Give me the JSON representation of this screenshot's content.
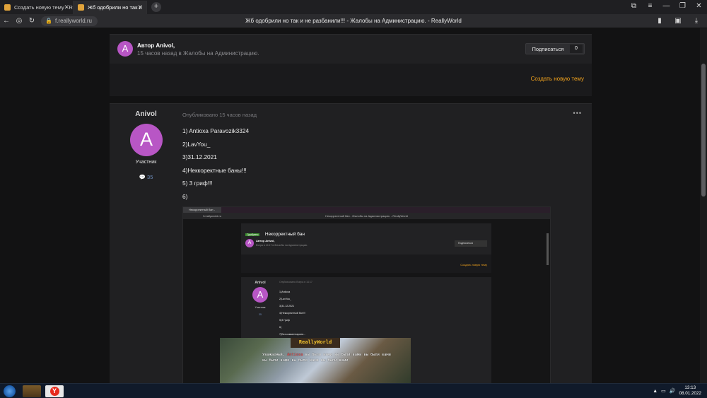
{
  "browser": {
    "tabs": [
      {
        "label": "Создать новую тему - Re",
        "active": false
      },
      {
        "label": "Жб одобрили но так и",
        "active": true
      }
    ],
    "new_tab_label": "+",
    "address": "f.reallyworld.ru",
    "page_title": "Жб одобрили но так и не разбанили!!! - Жалобы на Администрацию. - ReallyWorld"
  },
  "topic_header": {
    "avatar_letter": "A",
    "author": "Автор Anivol,",
    "meta": "15 часов назад в Жалобы на Администрацию.",
    "subscribe_label": "Подписаться",
    "subscribe_count": "0"
  },
  "actions": {
    "create_topic": "Создать новую тему"
  },
  "post": {
    "username": "Anivol",
    "avatar_letter": "A",
    "role": "Участник",
    "post_count": "35",
    "published": "Опубликовано 15 часов назад",
    "more": "•••",
    "lines": [
      "1) Antioxa Paravozik3324",
      "2)LavYou_",
      "3)31.12.2021",
      "4)Неккоректные баны!!!",
      "5) 3 гриф!!!",
      "6)"
    ]
  },
  "embedded_screenshot": {
    "tab": "Некорректный бан -",
    "address": "f.reallyworld.ru",
    "page_title": "Некорректный бан - Жалобы на Администрацию. - ReallyWorld",
    "tag": "Одобрено",
    "title": "Некорректный бан",
    "author": "Автор Anivol,",
    "meta": "Вчера в 14:17 в Жалобы на Администрацию.",
    "subscribe": "Подписаться",
    "create_topic": "Создать новую тему",
    "username": "Anivol",
    "avatar_letter": "A",
    "role": "Участник",
    "count": "35",
    "published": "Опубликовано Вчера в 14:17",
    "lines": [
      "1)Antioxa",
      "2)LavYou_",
      "3)31.12.2021",
      "4)Неккоректный бан!!!",
      "5)3 Гриф",
      "6)",
      "7)Без комментариев..."
    ],
    "mc_title": "ReallyWorld",
    "mc_text_1": "Уважаемый,",
    "mc_name": "Antioxa",
    "mc_text_2": "вы были вами вы были вами вы были вами вы были вами вы были вами вы были вами"
  },
  "taskbar": {
    "time": "13:13",
    "date": "08.01.2022"
  }
}
